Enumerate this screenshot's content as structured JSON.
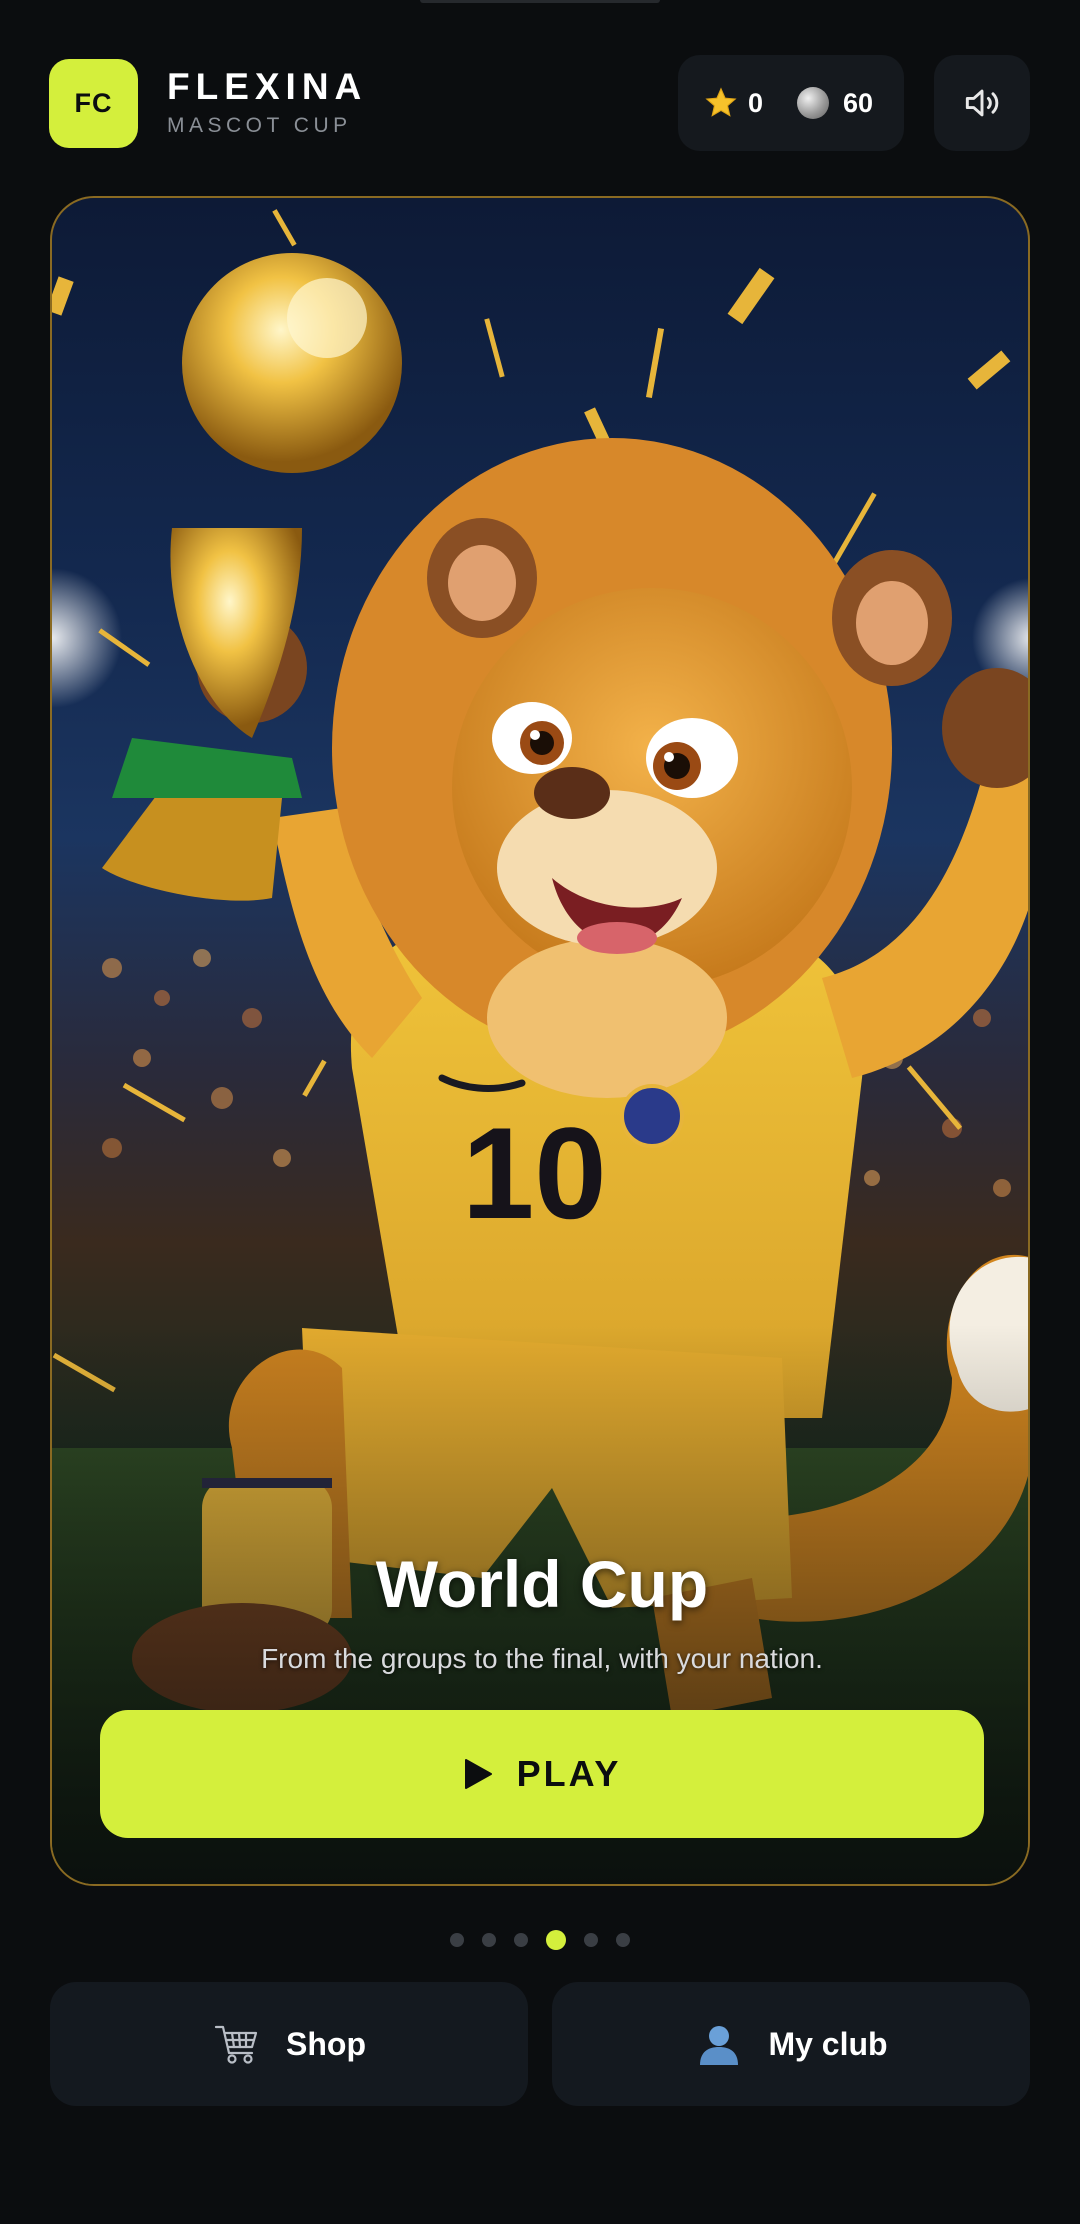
{
  "header": {
    "logo_text": "FC",
    "brand_name": "FLEXINA",
    "brand_sub": "MASCOT CUP",
    "stars": "0",
    "coins": "60",
    "icons": {
      "star": "star-icon",
      "coin": "coin-icon",
      "sound": "speaker-icon"
    }
  },
  "card": {
    "title": "World Cup",
    "description": "From the groups to the final, with your nation.",
    "play_label": "PLAY",
    "image_alt_icon": "lion-mascot-trophy-illustration"
  },
  "carousel": {
    "count": 6,
    "active_index": 3
  },
  "bottom": {
    "shop_label": "Shop",
    "club_label": "My club"
  },
  "colors": {
    "accent": "#d4ef3c",
    "background": "#0b0d0f",
    "panel": "#15191e"
  }
}
